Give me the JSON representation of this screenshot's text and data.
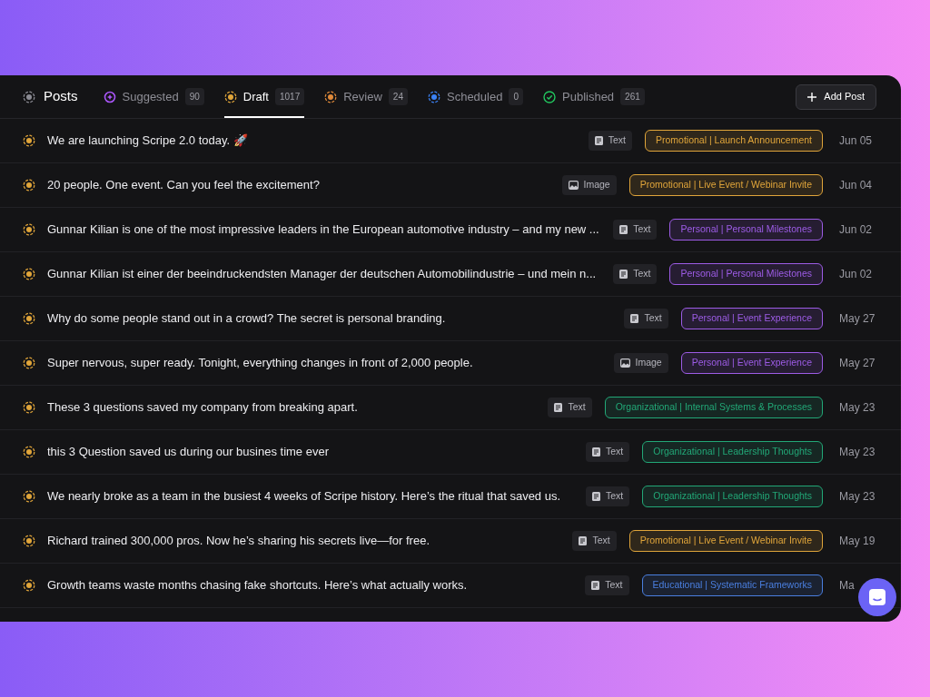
{
  "header": {
    "title": "Posts"
  },
  "tabs": [
    {
      "label": "Suggested",
      "count": "90",
      "kind": "sparkle",
      "color": "#a855f7",
      "selected": false
    },
    {
      "label": "Draft",
      "count": "1017",
      "kind": "ring",
      "color": "#e0a53a",
      "selected": true
    },
    {
      "label": "Review",
      "count": "24",
      "kind": "ring",
      "color": "#e08a3a",
      "selected": false
    },
    {
      "label": "Scheduled",
      "count": "0",
      "kind": "ring",
      "color": "#3b82f6",
      "selected": false
    },
    {
      "label": "Published",
      "count": "261",
      "kind": "check",
      "color": "#22c55e",
      "selected": false
    }
  ],
  "add_button": {
    "label": "Add Post"
  },
  "posts": [
    {
      "title": "We are launching Scripe 2.0 today. 🚀",
      "type": {
        "kind": "text",
        "label": "Text"
      },
      "tag": {
        "label": "Promotional | Launch Announcement",
        "color": "#e0a53a"
      },
      "date": "Jun 05"
    },
    {
      "title": "20 people. One event. Can you feel the excitement?",
      "type": {
        "kind": "image",
        "label": "Image"
      },
      "tag": {
        "label": "Promotional | Live Event / Webinar Invite",
        "color": "#e0a53a"
      },
      "date": "Jun 04"
    },
    {
      "title": "Gunnar Kilian is one of the most impressive leaders in the European automotive industry – and my new ...",
      "type": {
        "kind": "text",
        "label": "Text"
      },
      "tag": {
        "label": "Personal | Personal Milestones",
        "color": "#9d5ce6"
      },
      "date": "Jun 02"
    },
    {
      "title": "Gunnar Kilian ist einer der beeindruckendsten Manager der deutschen Automobilindustrie – und mein n...",
      "type": {
        "kind": "text",
        "label": "Text"
      },
      "tag": {
        "label": "Personal | Personal Milestones",
        "color": "#9d5ce6"
      },
      "date": "Jun 02"
    },
    {
      "title": "Why do some people stand out in a crowd? The secret is personal branding.",
      "type": {
        "kind": "text",
        "label": "Text"
      },
      "tag": {
        "label": "Personal | Event Experience",
        "color": "#9d5ce6"
      },
      "date": "May 27"
    },
    {
      "title": "Super nervous, super ready. Tonight, everything changes in front of 2,000 people.",
      "type": {
        "kind": "image",
        "label": "Image"
      },
      "tag": {
        "label": "Personal | Event Experience",
        "color": "#9d5ce6"
      },
      "date": "May 27"
    },
    {
      "title": "These 3 questions saved my company from breaking apart.",
      "type": {
        "kind": "text",
        "label": "Text"
      },
      "tag": {
        "label": "Organizational | Internal Systems & Processes",
        "color": "#22a877"
      },
      "date": "May 23"
    },
    {
      "title": "this 3 Question saved us during our busines time ever",
      "type": {
        "kind": "text",
        "label": "Text"
      },
      "tag": {
        "label": "Organizational | Leadership Thoughts",
        "color": "#22a877"
      },
      "date": "May 23"
    },
    {
      "title": "We nearly broke as a team in the busiest 4 weeks of Scripe history. Here’s the ritual that saved us.",
      "type": {
        "kind": "text",
        "label": "Text"
      },
      "tag": {
        "label": "Organizational | Leadership Thoughts",
        "color": "#22a877"
      },
      "date": "May 23"
    },
    {
      "title": "Richard trained 300,000 pros. Now he’s sharing his secrets live—for free.",
      "type": {
        "kind": "text",
        "label": "Text"
      },
      "tag": {
        "label": "Promotional | Live Event / Webinar Invite",
        "color": "#e0a53a"
      },
      "date": "May 19"
    },
    {
      "title": "Growth teams waste months chasing fake shortcuts. Here’s what actually works.",
      "type": {
        "kind": "text",
        "label": "Text"
      },
      "tag": {
        "label": "Educational | Systematic Frameworks",
        "color": "#4a7fe0"
      },
      "date": "Ma"
    }
  ]
}
